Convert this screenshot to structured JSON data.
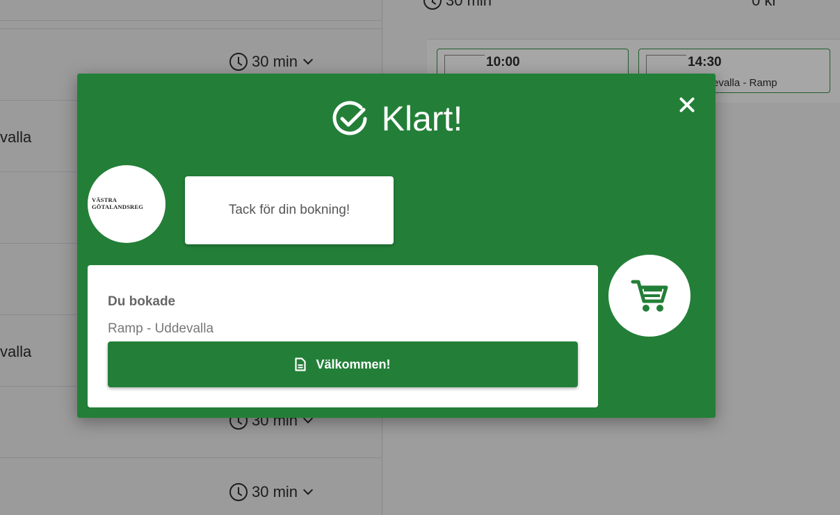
{
  "background": {
    "rows": [
      {
        "text": "",
        "duration": "30 min"
      },
      {
        "text": "valla",
        "duration": ""
      },
      {
        "text": "",
        "duration": ""
      },
      {
        "text": "valla",
        "duration": ""
      },
      {
        "text": "",
        "duration": "30 min"
      },
      {
        "text": "",
        "duration": "30 min"
      }
    ],
    "top_duration": "30 min",
    "top_right_text": "0 kr",
    "slots": [
      {
        "time": "10:00",
        "location": ""
      },
      {
        "time": "14:30",
        "location": "evalla - Ramp"
      }
    ]
  },
  "modal": {
    "title": "Klart!",
    "avatar_text": "VÄSTRA GÖTALANDSREG",
    "message": "Tack för din bokning!",
    "summary_heading": "Du bokade",
    "summary_detail": "Ramp - Uddevalla",
    "primary_button": "Välkommen!"
  },
  "colors": {
    "brand_green": "#237f38",
    "overlay_gray": "#999999"
  }
}
